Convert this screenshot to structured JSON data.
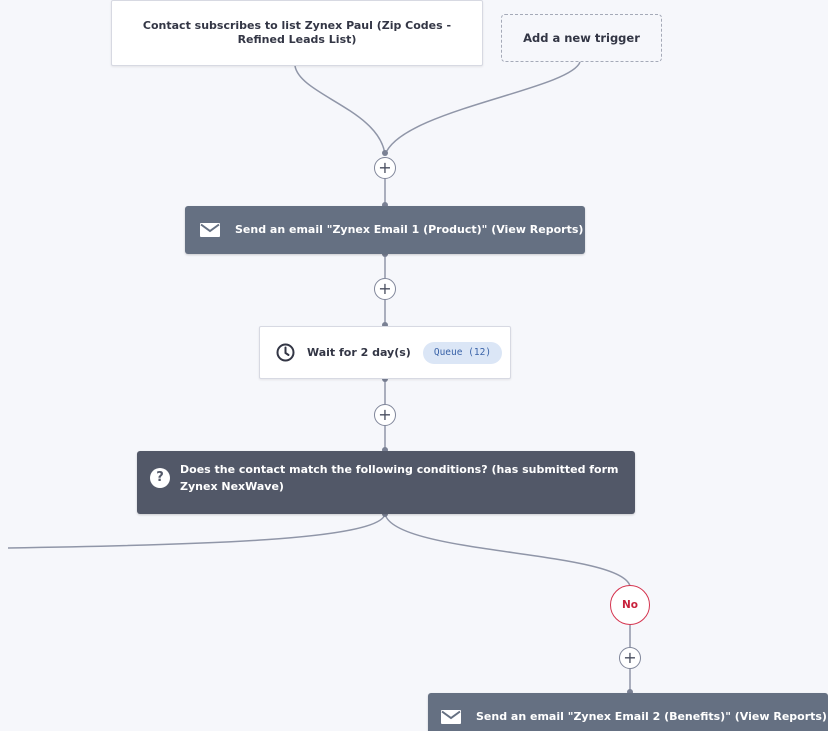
{
  "triggers": {
    "existing_label": "Contact subscribes to list Zynex Paul (Zip Codes - Refined Leads List)",
    "add_label": "Add a new trigger"
  },
  "steps": {
    "email1_label": "Send an email \"Zynex Email 1 (Product)\" (View Reports)",
    "wait_label": "Wait for 2 day(s)",
    "wait_queue": "Queue (12)",
    "condition_icon": "?",
    "condition_label": "Does the contact match the following conditions? (has submitted form Zynex NexWave)",
    "branch_no_label": "No",
    "email2_label": "Send an email \"Zynex Email 2 (Benefits)\" (View Reports)"
  },
  "controls": {
    "add_step_symbol": "+"
  },
  "colors": {
    "canvas_bg": "#f6f7fb",
    "action_bg": "#657082",
    "condition_bg": "#525868",
    "connector": "#9096a8",
    "branch_no": "#d5334e",
    "queue_bg": "#dbe6f6",
    "queue_text": "#3a63a8"
  },
  "icons": [
    "mail-icon",
    "clock-icon",
    "question-icon",
    "plus-icon"
  ]
}
